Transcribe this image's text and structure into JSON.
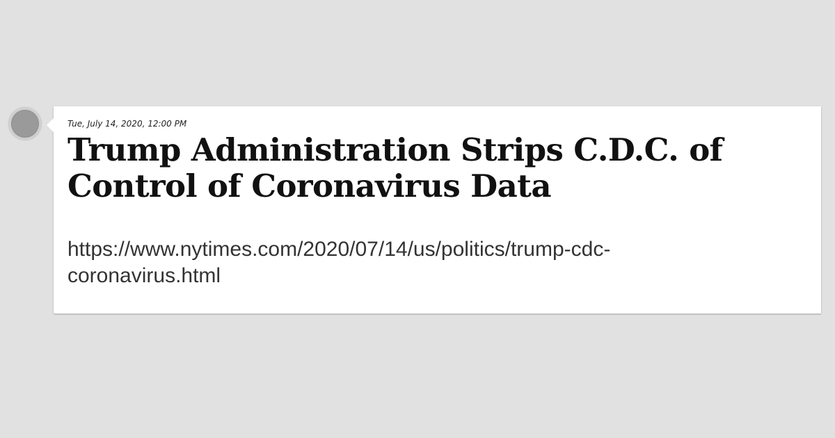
{
  "post": {
    "timestamp": "Tue, July 14, 2020, 12:00 PM",
    "headline": "Trump Administration Strips C.D.C. of Control of Coronavirus Data",
    "url": "https://www.nytimes.com/2020/07/14/us/politics/trump-cdc-coronavirus.html"
  },
  "colors": {
    "background": "#e1e1e1",
    "card": "#ffffff",
    "marker": "#9a9a9a"
  }
}
